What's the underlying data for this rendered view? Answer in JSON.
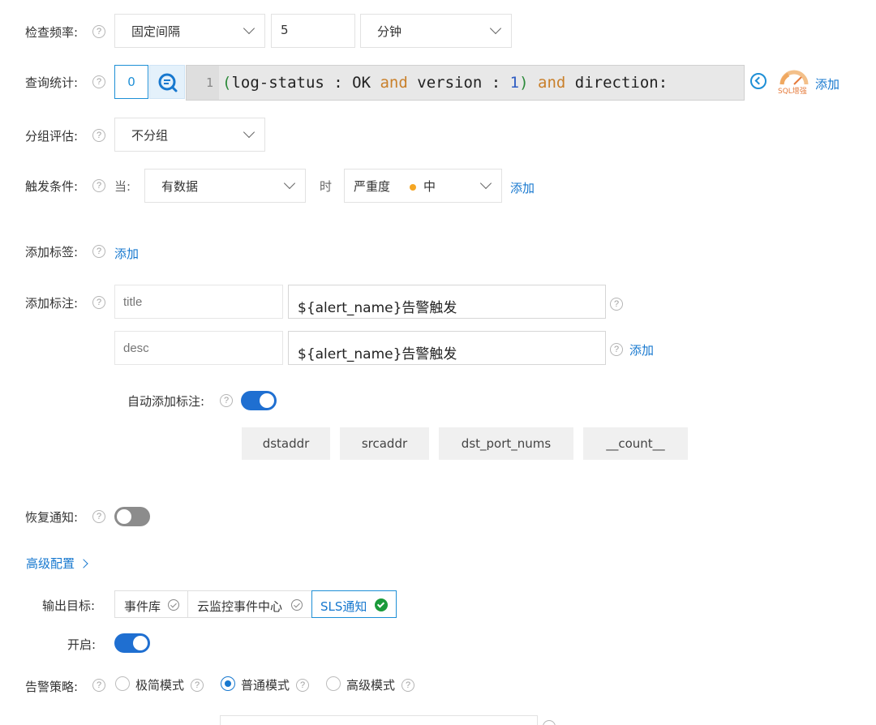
{
  "check_frequency": {
    "label": "检查频率:",
    "mode": "固定间隔",
    "interval": "5",
    "unit": "分钟"
  },
  "query_stats": {
    "label": "查询统计:",
    "index": "0",
    "line_number": "1",
    "query_tokens": {
      "open_paren": "(",
      "p1": "log-status : OK ",
      "and1": "and",
      "p2": " version : ",
      "num1": "1",
      "close_paren": ")",
      "sp": " ",
      "and2": "and",
      "p3": " direction:"
    },
    "sql_badge": "SQL增强",
    "add": "添加"
  },
  "group_eval": {
    "label": "分组评估:",
    "value": "不分组"
  },
  "trigger": {
    "label": "触发条件:",
    "when": "当:",
    "condition": "有数据",
    "then": "时",
    "severity_label": "严重度",
    "severity_value": "中",
    "severity_color": "#f5a623",
    "add": "添加"
  },
  "tags": {
    "label": "添加标签:",
    "add": "添加"
  },
  "annotations": {
    "label": "添加标注:",
    "rows": [
      {
        "key_placeholder": "title",
        "value": "${alert_name}告警触发"
      },
      {
        "key_placeholder": "desc",
        "value": "${alert_name}告警触发"
      }
    ],
    "add": "添加",
    "auto_label": "自动添加标注:",
    "auto_enabled": true,
    "auto_fields": [
      "dstaddr",
      "srcaddr",
      "dst_port_nums",
      "__count__"
    ]
  },
  "recovery": {
    "label": "恢复通知:",
    "enabled": false
  },
  "advanced": {
    "label": "高级配置",
    "output_label": "输出目标:",
    "targets": [
      "事件库",
      "云监控事件中心",
      "SLS通知"
    ],
    "selected_target": "SLS通知",
    "enable_label": "开启:",
    "enabled": true,
    "policy_label": "告警策略:",
    "policies": [
      "极简模式",
      "普通模式",
      "高级模式"
    ],
    "selected_policy": "普通模式"
  },
  "colors": {
    "accent": "#1778cf",
    "toggle_on": "#1f6fd1",
    "toggle_off": "#8c8c8c",
    "success": "#1a9a3a"
  }
}
